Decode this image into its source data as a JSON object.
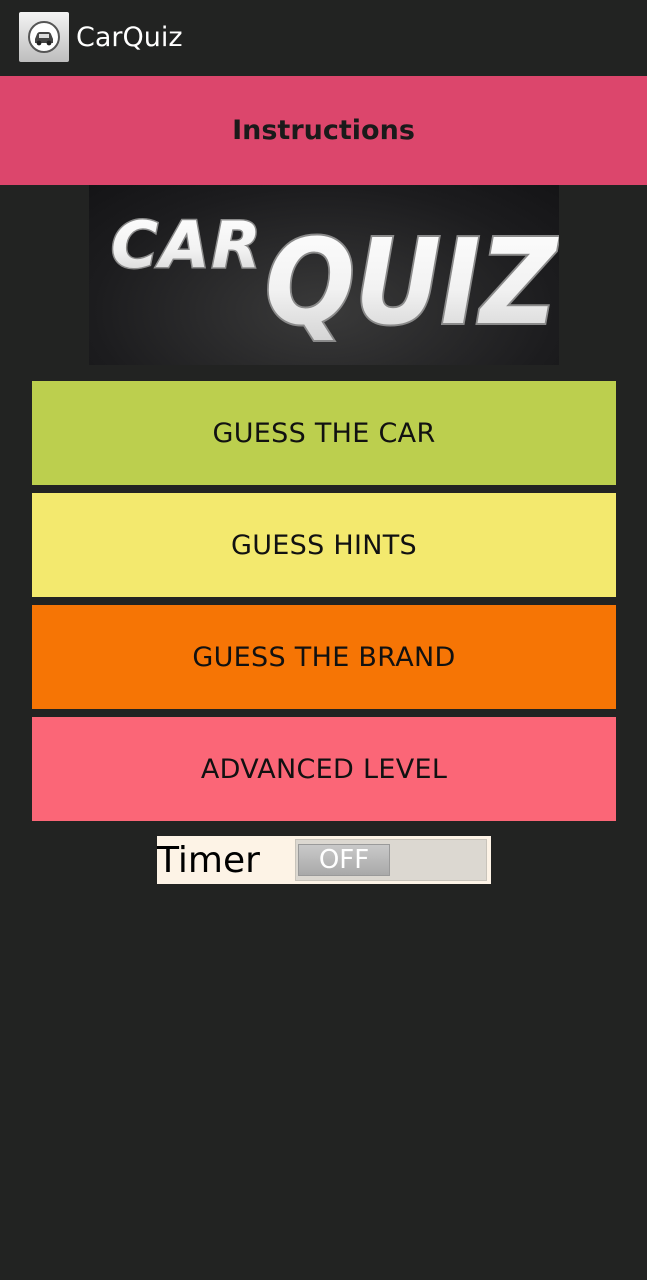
{
  "app": {
    "title": "CarQuiz",
    "icon": "car-icon"
  },
  "instructions": {
    "label": "Instructions",
    "color": "#dc466c"
  },
  "logo": {
    "text_car": "CAR",
    "text_quiz": "QUIZ"
  },
  "menu": [
    {
      "label": "GUESS THE CAR",
      "color": "#bccf4e"
    },
    {
      "label": "GUESS HINTS",
      "color": "#f3e96e"
    },
    {
      "label": "GUESS THE BRAND",
      "color": "#f67505"
    },
    {
      "label": "ADVANCED LEVEL",
      "color": "#fb6677"
    }
  ],
  "timer": {
    "label": "Timer",
    "state": "OFF"
  }
}
